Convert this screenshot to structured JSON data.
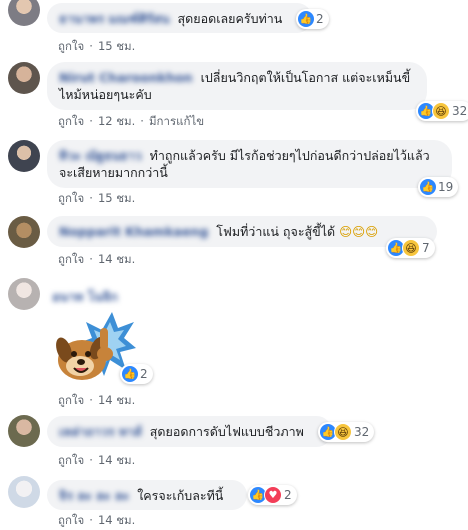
{
  "comments": [
    {
      "name": "ธานาพร มณฑ์ศิรัสน",
      "text": "สุดยอดเลยครับท่าน",
      "like_label": "ถูกใจ",
      "time": "15 ชม.",
      "reaction_count": "2",
      "reactions": [
        "like"
      ]
    },
    {
      "name": "Nirut Charoonkhon",
      "text": "เปลี่ยนวิกฤตให้เป็นโอกาส แต่จะเหม็นขี้ไหม้หน่อยๆนะคับ",
      "like_label": "ถูกใจ",
      "time": "12 ชม.",
      "edited": "มีการแก้ไข",
      "reaction_count": "32",
      "reactions": [
        "like",
        "haha"
      ]
    },
    {
      "name": "ทิวะ ณัฐธนธาว",
      "text": "ทำถูกแล้วครับ มีไรก้อช่วยๆไปก่อนดีกว่าปล่อยไว้แล้วจะเสียหายมากกว่านี้",
      "like_label": "ถูกใจ",
      "time": "15 ชม.",
      "reaction_count": "19",
      "reactions": [
        "like"
      ]
    },
    {
      "name": "Nopparit Khamkaeng",
      "text": "โฟมที่ว่าแน่ ถุจะสู้ขี้ได้",
      "emoji": "😊😊😊",
      "like_label": "ถูกใจ",
      "time": "14 ชม.",
      "reaction_count": "7",
      "reactions": [
        "like",
        "haha"
      ]
    },
    {
      "name": "อนาท โนจิก",
      "like_label": "ถูกใจ",
      "time": "14 ชม.",
      "sticker": "dog-thumbs-up-sticker",
      "reaction_count": "2",
      "reactions": [
        "like"
      ]
    },
    {
      "name": "เหล่าถาวร ทาส์",
      "text": "สุดยอดการดับไฟแบบชีวภาพ",
      "like_label": "ถูกใจ",
      "time": "14 ชม.",
      "reaction_count": "32",
      "reactions": [
        "like",
        "haha"
      ]
    },
    {
      "name": "จิร ละ ละ ละ",
      "text": "ใครจะเก้บละทีนี้",
      "like_label": "ถูกใจ",
      "time": "14 ชม.",
      "reaction_count": "2",
      "reactions": [
        "like",
        "love"
      ]
    }
  ],
  "colors": {
    "name": "#385898",
    "bubble": "#f2f3f5",
    "meta": "#606770",
    "like": "#2d88ff",
    "haha": "#f7c53d",
    "love": "#f33e58"
  },
  "icons": {
    "like": "thumbs-up-icon",
    "haha": "laughing-face-icon",
    "love": "heart-icon"
  }
}
